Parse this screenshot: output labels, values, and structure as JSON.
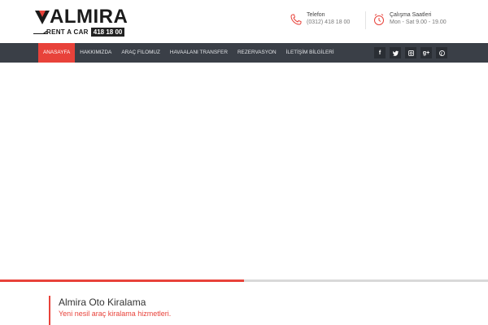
{
  "header": {
    "logo": {
      "brand": "ALMIRA",
      "subtitle": "RENT A CAR",
      "phone": "418 18 00"
    },
    "phone": {
      "icon": "phone-icon",
      "title": "Telefon",
      "value": "(0312) 418 18 00"
    },
    "hours": {
      "icon": "clock-icon",
      "title": "Çalışma Saatleri",
      "value": "Mon - Sat 9.00 - 19.00"
    }
  },
  "nav": {
    "items": [
      {
        "label": "ANASAYFA",
        "active": true
      },
      {
        "label": "HAKKIMIZDA",
        "active": false
      },
      {
        "label": "ARAÇ FILOMUZ",
        "active": false
      },
      {
        "label": "HAVAALANI TRANSFER",
        "active": false
      },
      {
        "label": "REZERVASYON",
        "active": false
      },
      {
        "label": "İLETİŞİM BİLGİLERİ",
        "active": false
      }
    ],
    "social": [
      {
        "name": "facebook-icon",
        "glyph": "f"
      },
      {
        "name": "twitter-icon",
        "glyph": "t"
      },
      {
        "name": "instagram-icon",
        "glyph": "◻"
      },
      {
        "name": "google-plus-icon",
        "glyph": "g+"
      },
      {
        "name": "pinterest-icon",
        "glyph": "p"
      }
    ]
  },
  "slider": {
    "progress": 0.5
  },
  "caption": {
    "title": "Almira Oto Kiralama",
    "subtitle": "Yeni nesil araç kiralama hizmetleri."
  },
  "colors": {
    "accent": "#e8423a",
    "nav_bg": "#3a3f47",
    "social_bg": "#2a2e34"
  }
}
